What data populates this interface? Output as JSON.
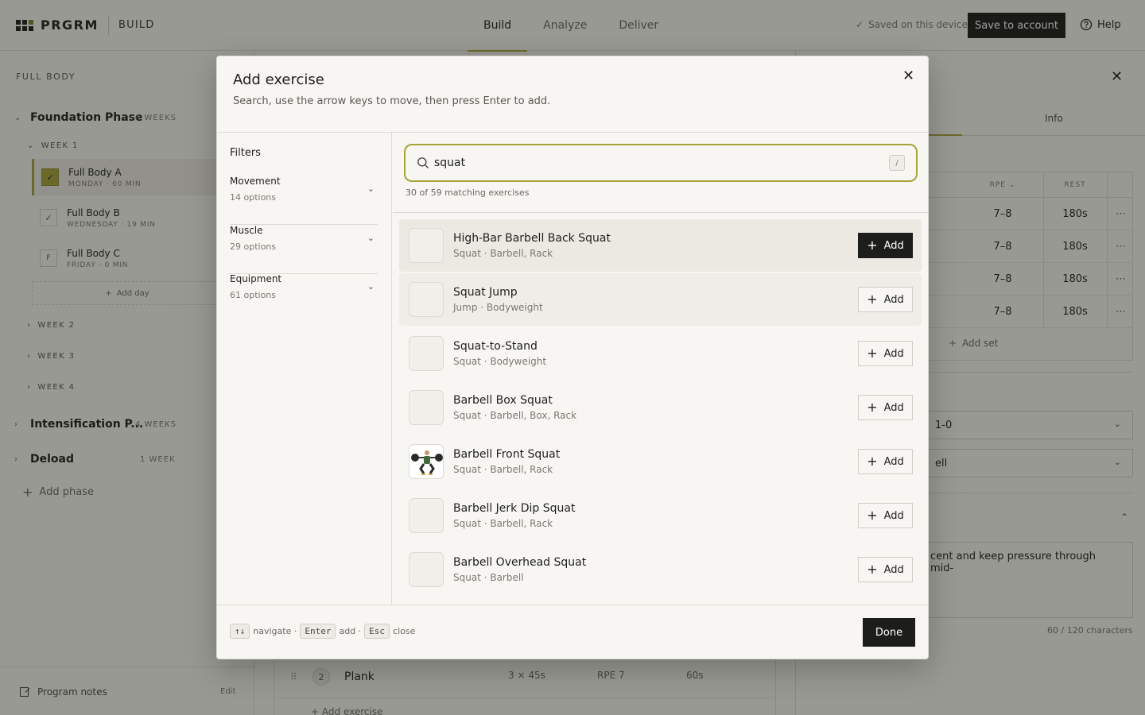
{
  "topbar": {
    "brand": "PRGRM",
    "section": "BUILD",
    "tabs": [
      {
        "label": "Build",
        "active": true
      },
      {
        "label": "Analyze",
        "active": false
      },
      {
        "label": "Deliver",
        "active": false
      }
    ],
    "saved_status": "Saved on this device",
    "save_button": "Save to account",
    "help": "Help"
  },
  "sidebar": {
    "program_title": "FULL BODY",
    "phases": [
      {
        "name": "Foundation Phase",
        "meta": "4 WEEKS",
        "expanded": true
      },
      {
        "name": "Intensification P...",
        "meta": "4 WEEKS",
        "expanded": false
      },
      {
        "name": "Deload",
        "meta": "1 WEEK",
        "expanded": false
      }
    ],
    "weeks": [
      "WEEK 1",
      "WEEK 2",
      "WEEK 3",
      "WEEK 4"
    ],
    "days": [
      {
        "name": "Full Body A",
        "meta": "MONDAY · 60 MIN",
        "check": "✓",
        "active": true
      },
      {
        "name": "Full Body B",
        "meta": "WEDNESDAY · 19 MIN",
        "check": "✓",
        "active": false
      },
      {
        "name": "Full Body C",
        "meta": "FRIDAY · 0 MIN",
        "check": "F",
        "active": false
      }
    ],
    "add_day": "Add day",
    "add_phase": "Add phase",
    "program_notes": "Program notes",
    "edit": "Edit"
  },
  "background": {
    "row": {
      "num": "2",
      "name": "Plank",
      "sets": "3 × 45s",
      "rpe": "RPE 7",
      "rest": "60s"
    },
    "add_exercise": "Add exercise"
  },
  "right_panel": {
    "tab_info": "Info",
    "columns": {
      "rpe": "RPE",
      "rest": "REST"
    },
    "sets": [
      {
        "rpe": "7–8",
        "rest": "180s"
      },
      {
        "rpe": "7–8",
        "rest": "180s"
      },
      {
        "rpe": "7–8",
        "rest": "180s"
      },
      {
        "rpe": "7–8",
        "rest": "180s"
      }
    ],
    "add_set": "Add set",
    "select_1": "1-0",
    "select_2": "ell",
    "notes_text": "cent and keep pressure through mid-",
    "char_count": "60 / 120 characters"
  },
  "modal": {
    "title": "Add exercise",
    "subtitle": "Search, use the arrow keys to move, then press Enter to add.",
    "filters_title": "Filters",
    "filters": [
      {
        "name": "Movement",
        "count": "14 options"
      },
      {
        "name": "Muscle",
        "count": "29 options"
      },
      {
        "name": "Equipment",
        "count": "61 options"
      }
    ],
    "search": {
      "value": "squat",
      "shortcut": "/"
    },
    "match_count": "30 of 59 matching exercises",
    "add_label": "Add",
    "results": [
      {
        "name": "High-Bar Barbell Back Squat",
        "tags": "Squat · Barbell, Rack",
        "highlighted": true,
        "has_image": false
      },
      {
        "name": "Squat Jump",
        "tags": "Jump · Bodyweight",
        "highlighted": false,
        "has_image": false
      },
      {
        "name": "Squat-to-Stand",
        "tags": "Squat · Bodyweight",
        "highlighted": false,
        "has_image": false
      },
      {
        "name": "Barbell Box Squat",
        "tags": "Squat · Barbell, Box, Rack",
        "highlighted": false,
        "has_image": false
      },
      {
        "name": "Barbell Front Squat",
        "tags": "Squat · Barbell, Rack",
        "highlighted": false,
        "has_image": true
      },
      {
        "name": "Barbell Jerk Dip Squat",
        "tags": "Squat · Barbell, Rack",
        "highlighted": false,
        "has_image": false
      },
      {
        "name": "Barbell Overhead Squat",
        "tags": "Squat · Barbell",
        "highlighted": false,
        "has_image": false
      }
    ],
    "footer": {
      "nav_key": "↑↓",
      "nav_label": "navigate ·",
      "enter_key": "Enter",
      "enter_label": "add ·",
      "esc_key": "Esc",
      "esc_label": "close",
      "done": "Done"
    }
  },
  "colors": {
    "accent": "#a7a43a",
    "dark": "#1d1d1b",
    "background": "#f7f6f2"
  }
}
